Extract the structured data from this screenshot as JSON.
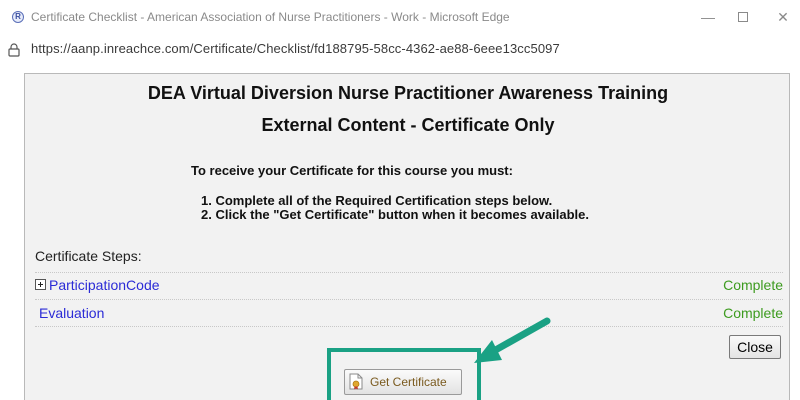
{
  "window": {
    "title": "Certificate Checklist - American Association of Nurse Practitioners - Work - Microsoft Edge",
    "app_icon": "edge-app-icon",
    "controls": {
      "minimize": "—",
      "close": "✕"
    }
  },
  "address_bar": {
    "url": "https://aanp.inreachce.com/Certificate/Checklist/fd188795-58cc-4362-ae88-6eee13cc5097"
  },
  "dialog": {
    "course_title": "DEA Virtual Diversion Nurse Practitioner Awareness Training",
    "subtitle": "External Content - Certificate Only",
    "instructions_heading": "To receive your Certificate for this course you must:",
    "instructions": [
      "1. Complete all of the Required Certification steps below.",
      "2. Click the \"Get Certificate\" button when it becomes available."
    ],
    "steps_label": "Certificate Steps:",
    "steps": [
      {
        "name": "ParticipationCode",
        "status": "Complete",
        "expandable": true
      },
      {
        "name": "Evaluation",
        "status": "Complete",
        "expandable": false
      }
    ],
    "close_label": "Close",
    "get_certificate_label": "Get Certificate"
  },
  "colors": {
    "link": "#2b2bd6",
    "complete_status": "#3d9b1f",
    "highlight": "#1aa184",
    "dialog_background": "#f2f2f2"
  }
}
